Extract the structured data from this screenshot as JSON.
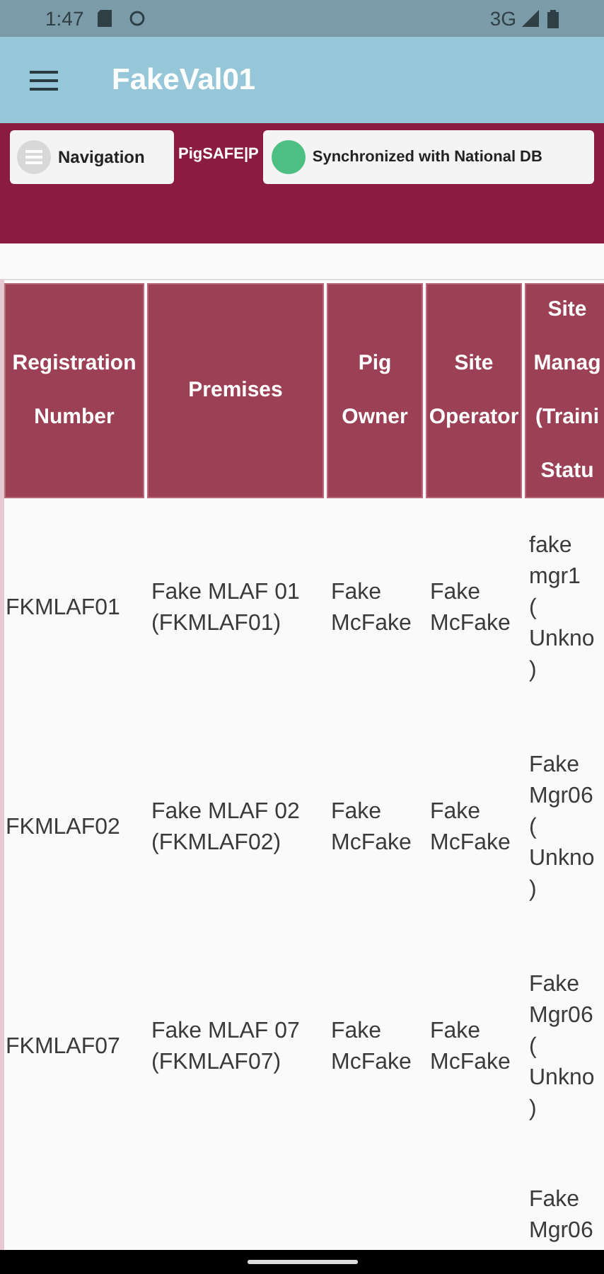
{
  "status_bar": {
    "time": "1:47",
    "network": "3G"
  },
  "app_bar": {
    "title": "FakeVal01"
  },
  "toolbar": {
    "navigation_button": "Navigation",
    "brand": "PigSAFE|P",
    "sync_status": {
      "label": "Synchronized with National DB",
      "color": "#4dbf82"
    }
  },
  "table": {
    "columns": [
      [
        "Registration",
        "Number"
      ],
      [
        "Premises"
      ],
      [
        "Pig",
        "Owner"
      ],
      [
        "Site",
        "Operator"
      ],
      [
        "Site",
        "Manag",
        "(Traini",
        "Statu"
      ]
    ],
    "rows": [
      {
        "registration": "FKMLAF01",
        "premises": [
          "Fake MLAF 01",
          "(FKMLAF01)"
        ],
        "owner": [
          "Fake",
          "McFake"
        ],
        "operator": [
          "Fake",
          "McFake"
        ],
        "manager": [
          "fake",
          "mgr1",
          "(",
          "Unkno",
          ")"
        ]
      },
      {
        "registration": "FKMLAF02",
        "premises": [
          "Fake MLAF 02",
          "(FKMLAF02)"
        ],
        "owner": [
          "Fake",
          "McFake"
        ],
        "operator": [
          "Fake",
          "McFake"
        ],
        "manager": [
          "Fake",
          "Mgr06",
          "(",
          "Unkno",
          ")"
        ]
      },
      {
        "registration": "FKMLAF07",
        "premises": [
          "Fake MLAF 07",
          "(FKMLAF07)"
        ],
        "owner": [
          "Fake",
          "McFake"
        ],
        "operator": [
          "Fake",
          "McFake"
        ],
        "manager": [
          "Fake",
          "Mgr06",
          "(",
          "Unkno",
          ")"
        ]
      },
      {
        "manager": [
          "Fake",
          "Mgr06"
        ]
      }
    ]
  }
}
